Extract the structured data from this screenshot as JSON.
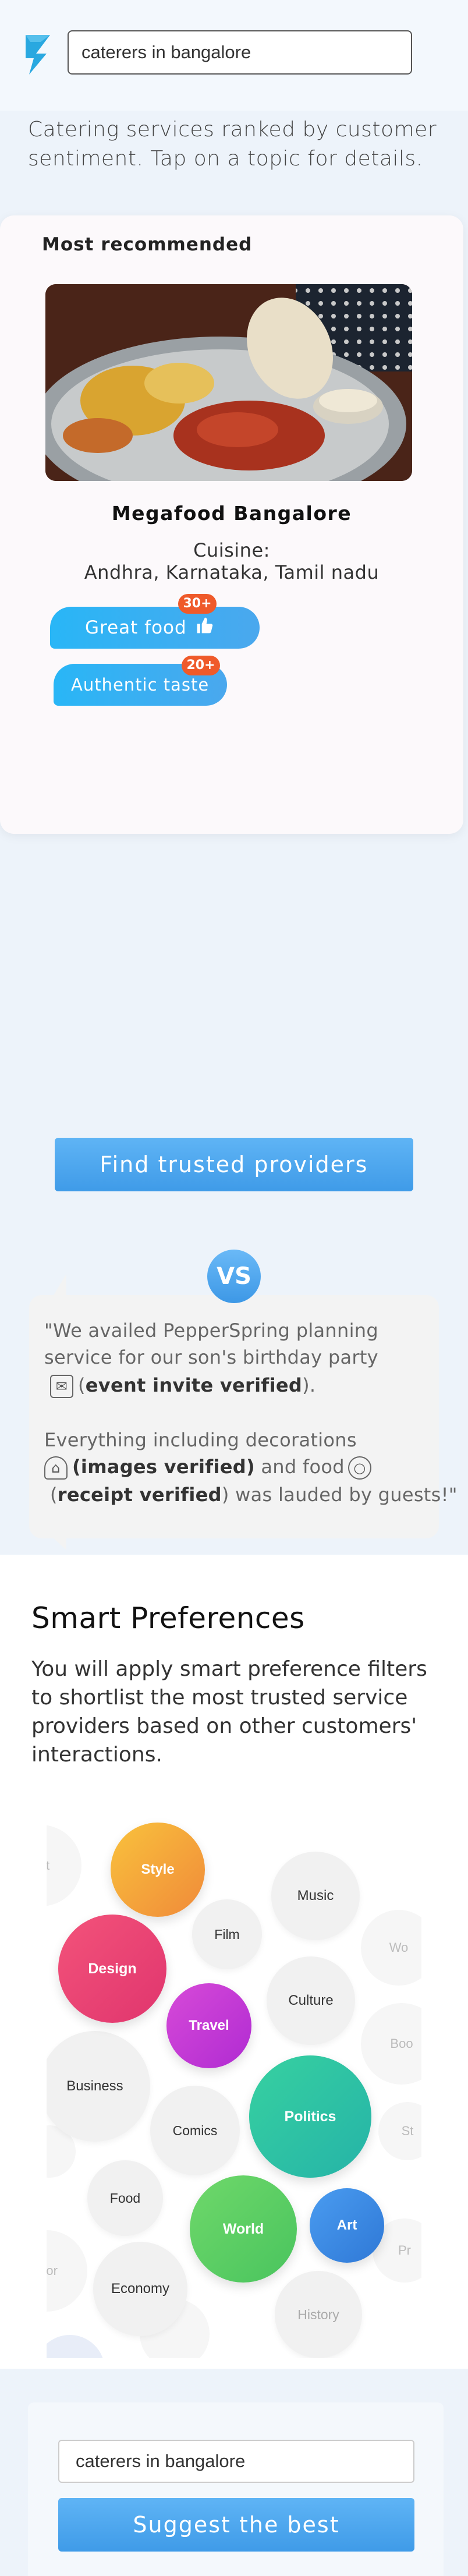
{
  "header": {
    "search_value": "caterers in bangalore"
  },
  "intro": "Catering services ranked by customer sentiment. Tap on a topic for details.",
  "recommended": {
    "heading": "Most recommended",
    "restaurant_name": "Megafood Bangalore",
    "cuisine_label": "Cuisine:",
    "cuisine_value": "Andhra, Karnataka, Tamil nadu",
    "tags": [
      {
        "label": "Great food",
        "badge": "30+"
      },
      {
        "label": "Authentic taste",
        "badge": "20+"
      }
    ]
  },
  "find_button": "Find trusted providers",
  "vs": "VS",
  "quote": {
    "line1": "\"We availed PepperSpring planning",
    "line2": "service for our son's birthday party",
    "line3_pre": "(",
    "line3_bold": "event invite verified",
    "line3_post": ").",
    "line4": "Everything including decorations",
    "line5_bold": "(images verified)",
    "line5_post": " and food",
    "line6_pre": "(",
    "line6_bold": "receipt verified",
    "line6_post": ") was lauded by guests!\""
  },
  "smart": {
    "title": "Smart Preferences",
    "description": "You will apply smart preference filters to shortlist the most trusted service providers based on other customers' interactions."
  },
  "bubbles": [
    {
      "label": "Style",
      "color": "#f6a33a"
    },
    {
      "label": "Design",
      "color": "#e8437a"
    },
    {
      "label": "Travel",
      "color": "#c33ad6"
    },
    {
      "label": "Politics",
      "color": "#2fc7a4"
    },
    {
      "label": "World",
      "color": "#5ed36a"
    },
    {
      "label": "Art",
      "color": "#3b8fe0"
    },
    {
      "label": "Music"
    },
    {
      "label": "Film"
    },
    {
      "label": "Culture"
    },
    {
      "label": "Business"
    },
    {
      "label": "Comics"
    },
    {
      "label": "Food"
    },
    {
      "label": "Economy"
    },
    {
      "label": "History"
    },
    {
      "label": "get"
    },
    {
      "label": "Wo"
    },
    {
      "label": "Boo"
    },
    {
      "label": "St"
    },
    {
      "label": "mor"
    },
    {
      "label": "Pr"
    }
  ],
  "bottom": {
    "search_value": "caterers in bangalore",
    "suggest_button": "Suggest the best"
  },
  "colors": {
    "accent_blue": "#3f9be8",
    "badge_orange": "#ef5a2a",
    "logo_blue": "#29a8e0"
  }
}
